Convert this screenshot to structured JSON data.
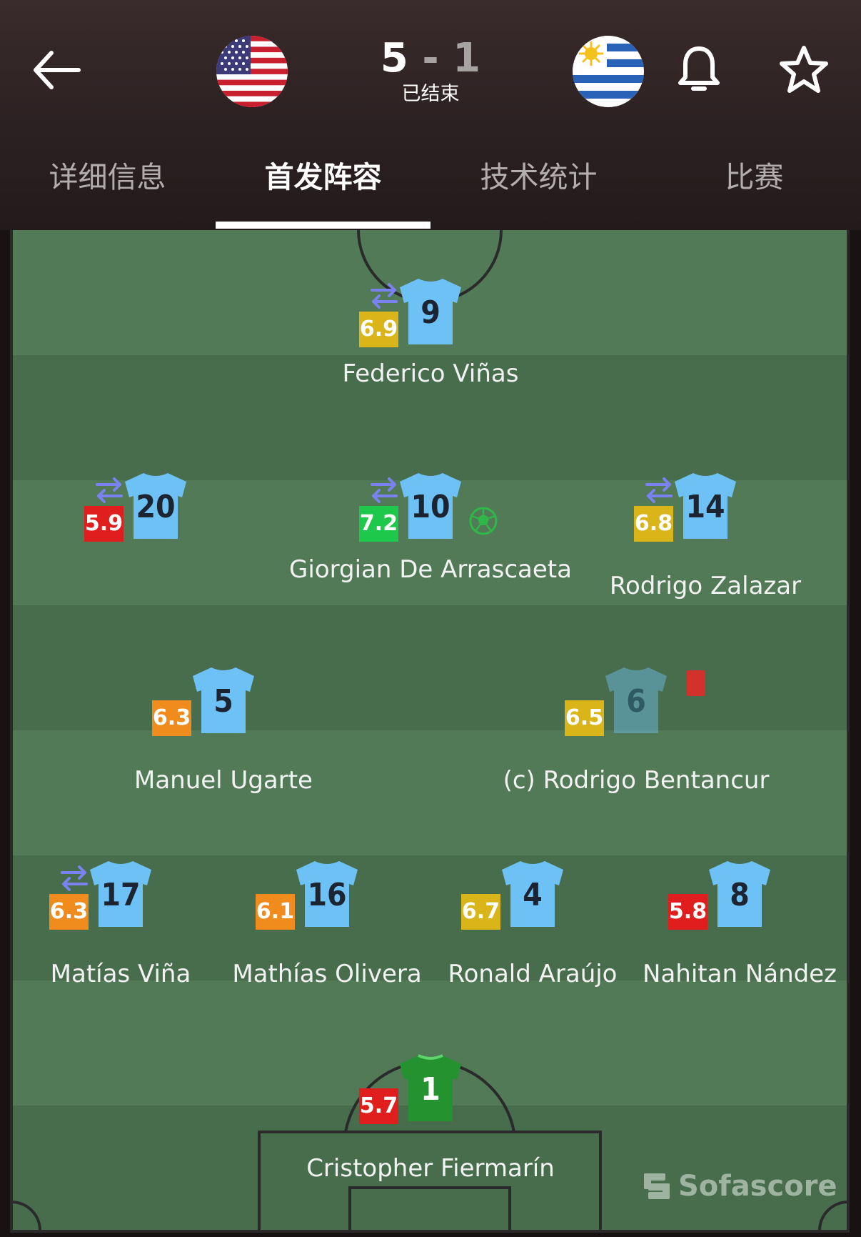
{
  "match": {
    "home_score": "5",
    "separator": "-",
    "away_score": "1",
    "status": "已结束",
    "home_flag": "usa-flag-icon",
    "away_flag": "uruguay-flag-icon"
  },
  "tabs": [
    {
      "label": "详细信息",
      "active": false
    },
    {
      "label": "首发阵容",
      "active": true
    },
    {
      "label": "技术统计",
      "active": false
    },
    {
      "label": "比赛",
      "active": false
    }
  ],
  "colors": {
    "pitch_light": "#527a57",
    "pitch_dark": "#476d4c",
    "shirt": "#6ec1f5",
    "keeper_shirt": "#23922f",
    "rating_red": "#e01e1e",
    "rating_orange": "#f08c1e",
    "rating_yellow": "#d9b51a",
    "rating_green": "#1ec84a",
    "sub_icon": "#7a82f2"
  },
  "players": [
    {
      "number": "9",
      "name": "Federico Viñas",
      "rating": "6.9",
      "rating_color": "#d9b51a",
      "substituted": true
    },
    {
      "number": "20",
      "name": "",
      "rating": "5.9",
      "rating_color": "#e01e1e",
      "substituted": true
    },
    {
      "number": "10",
      "name": "Giorgian De Arrascaeta",
      "rating": "7.2",
      "rating_color": "#1ec84a",
      "substituted": true,
      "goal": true
    },
    {
      "number": "14",
      "name": "Rodrigo Zalazar",
      "rating": "6.8",
      "rating_color": "#d9b51a",
      "substituted": true
    },
    {
      "number": "5",
      "name": "Manuel Ugarte",
      "rating": "6.3",
      "rating_color": "#f08c1e"
    },
    {
      "number": "6",
      "name": "(c) Rodrigo Bentancur",
      "rating": "6.5",
      "rating_color": "#d9b51a",
      "red_card": true
    },
    {
      "number": "17",
      "name": "Matías Viña",
      "rating": "6.3",
      "rating_color": "#f08c1e",
      "substituted": true
    },
    {
      "number": "16",
      "name": "Mathías Olivera",
      "rating": "6.1",
      "rating_color": "#f08c1e"
    },
    {
      "number": "4",
      "name": "Ronald Araújo",
      "rating": "6.7",
      "rating_color": "#d9b51a"
    },
    {
      "number": "8",
      "name": "Nahitan Nández",
      "rating": "5.8",
      "rating_color": "#e01e1e"
    },
    {
      "number": "1",
      "name": "Cristopher Fiermarín",
      "rating": "5.7",
      "rating_color": "#e01e1e",
      "goalkeeper": true
    }
  ],
  "brand": "Sofascore"
}
